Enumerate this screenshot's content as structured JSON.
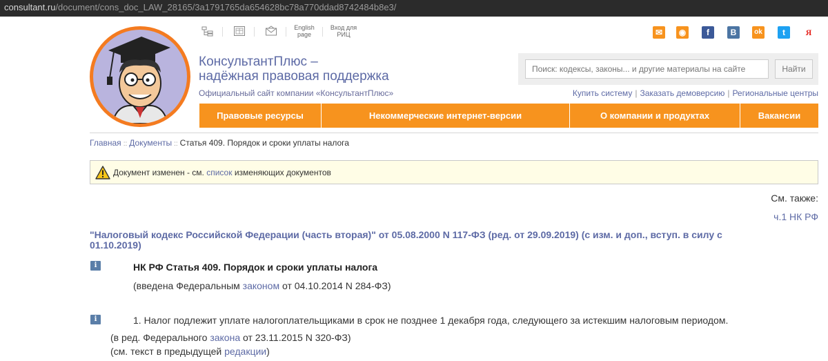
{
  "browser": {
    "url_host": "consultant.ru",
    "url_path": "/document/cons_doc_LAW_28165/3a1791765da654628bc78a770ddad8742484b8e3/"
  },
  "header": {
    "top_links": [
      {
        "icon": "sitemap-icon",
        "label": ""
      },
      {
        "icon": "calendar-icon",
        "label": ""
      },
      {
        "icon": "envelope-icon",
        "label": ""
      },
      {
        "icon": "",
        "label": "English page"
      },
      {
        "icon": "",
        "label": "Вход для РИЦ"
      }
    ],
    "brand_line1": "КонсультантПлюс –",
    "brand_line2": "надёжная правовая поддержка",
    "subtitle": "Официальный сайт компании «КонсультантПлюс»",
    "social": [
      {
        "icon": "mail-icon",
        "color": "#f7931e",
        "glyph": "✉"
      },
      {
        "icon": "rss-icon",
        "color": "#f7931e",
        "glyph": "◉"
      },
      {
        "icon": "facebook-icon",
        "color": "#3b5998",
        "glyph": "f"
      },
      {
        "icon": "vk-icon",
        "color": "#4c75a3",
        "glyph": "B"
      },
      {
        "icon": "odnoklassniki-icon",
        "color": "#f7931e",
        "glyph": "ok"
      },
      {
        "icon": "twitter-icon",
        "color": "#1da1f2",
        "glyph": "t"
      },
      {
        "icon": "yandex-icon",
        "color": "#ffffff",
        "glyph": "Я"
      }
    ],
    "search_placeholder": "Поиск: кодексы, законы... и другие материалы на сайте",
    "search_button": "Найти",
    "sublinks": [
      "Купить систему",
      "Заказать демоверсию",
      "Региональные центры"
    ]
  },
  "nav": [
    "Правовые ресурсы",
    "Некоммерческие интернет-версии",
    "О компании и продуктах",
    "Вакансии"
  ],
  "breadcrumb": [
    "Главная",
    "Документы",
    "Статья 409. Порядок и сроки уплаты налога"
  ],
  "notice": {
    "before": "Документ изменен - см. ",
    "link": "список",
    "after": " изменяющих документов"
  },
  "see_also": {
    "label": "См. также:",
    "link": "ч.1 НК РФ"
  },
  "document": {
    "title": "\"Налоговый кодекс Российской Федерации (часть вторая)\" от 05.08.2000 N 117-ФЗ (ред. от 29.09.2019) (с изм. и доп., вступ. в силу с 01.10.2019)",
    "article_title": "НК РФ Статья 409. Порядок и сроки уплаты налога",
    "article_note_before": "(введена Федеральным ",
    "article_note_link": "законом",
    "article_note_after": " от 04.10.2014 N 284-ФЗ)",
    "p1": "1. Налог подлежит уплате налогоплательщиками в срок не позднее 1 декабря года, следующего за истекшим налоговым периодом.",
    "p1_note1_before": "(в ред. Федерального ",
    "p1_note1_link": "закона",
    "p1_note1_after": " от 23.11.2015 N 320-ФЗ)",
    "p1_note2_before": "(см. текст в предыдущей ",
    "p1_note2_link": "редакции",
    "p1_note2_after": ")"
  }
}
